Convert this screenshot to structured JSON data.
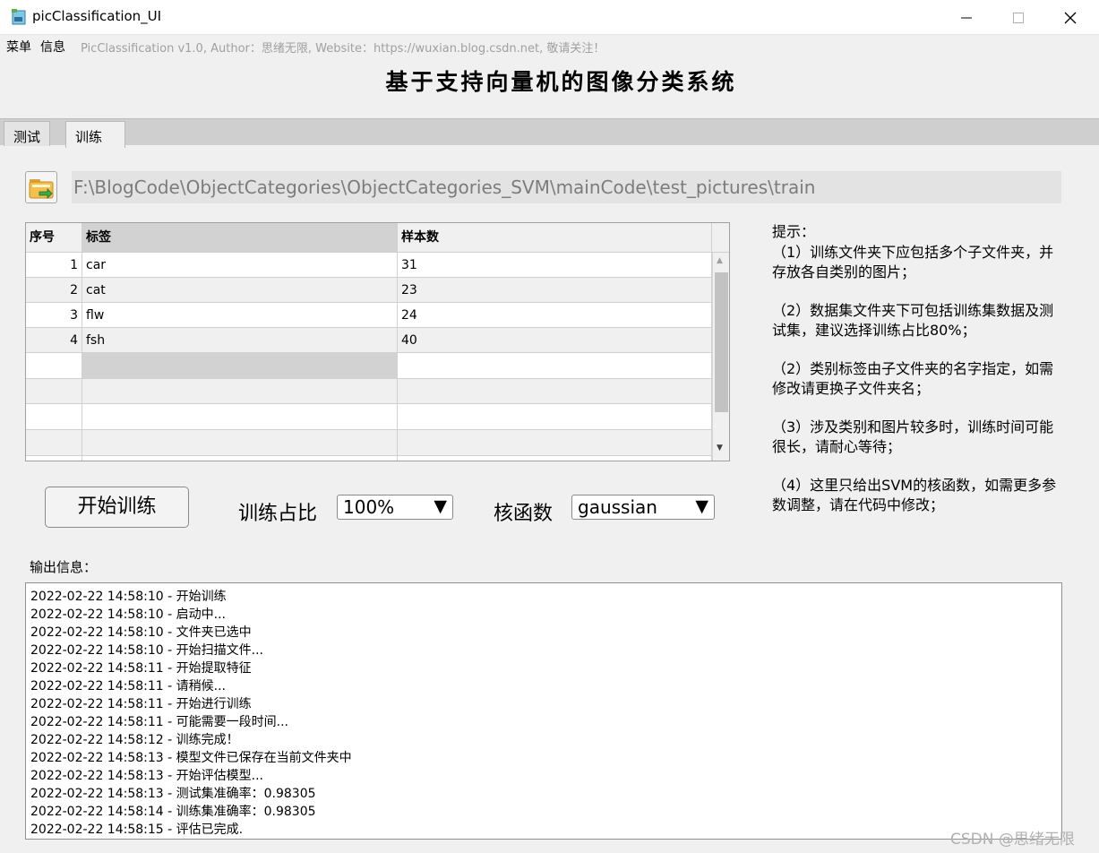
{
  "window": {
    "title": "picClassification_UI"
  },
  "menu": {
    "file": "菜单",
    "info": "信息",
    "credit": "PicClassification v1.0, Author：思绪无限, Website：https://wuxian.blog.csdn.net, 敬请关注！"
  },
  "heading": "基于支持向量机的图像分类系统",
  "tabs": {
    "test": "测试",
    "train": "训练"
  },
  "path": "F:\\BlogCode\\ObjectCategories\\ObjectCategories_SVM\\mainCode\\test_pictures\\train",
  "table": {
    "headers": [
      "序号",
      "标签",
      "样本数"
    ],
    "rows": [
      {
        "index": "1",
        "label": "car",
        "count": "31"
      },
      {
        "index": "2",
        "label": "cat",
        "count": "23"
      },
      {
        "index": "3",
        "label": "flw",
        "count": "24"
      },
      {
        "index": "4",
        "label": "fsh",
        "count": "40"
      }
    ]
  },
  "hints": {
    "title": "提示：",
    "items": [
      "（1）训练文件夹下应包括多个子文件夹，并存放各自类别的图片；",
      "（2）数据集文件夹下可包括训练集数据及测试集，建议选择训练占比80%；",
      "（2）类别标签由子文件夹的名字指定，如需修改请更换子文件夹名；",
      "（3）涉及类别和图片较多时，训练时间可能很长，请耐心等待；",
      "（4）这里只给出SVM的核函数，如需更多参数调整，请在代码中修改；"
    ]
  },
  "controls": {
    "start_label": "开始训练",
    "ratio_label": "训练占比",
    "ratio_value": "100%",
    "kernel_label": "核函数",
    "kernel_value": "gaussian"
  },
  "output": {
    "label": "输出信息：",
    "lines": [
      "2022-02-22 14:58:10 - 开始训练",
      "2022-02-22 14:58:10 - 启动中...",
      "2022-02-22 14:58:10 - 文件夹已选中",
      "2022-02-22 14:58:10 - 开始扫描文件...",
      "2022-02-22 14:58:11 - 开始提取特征",
      "2022-02-22 14:58:11 - 请稍候...",
      "2022-02-22 14:58:11 - 开始进行训练",
      "2022-02-22 14:58:11 - 可能需要一段时间...",
      "2022-02-22 14:58:12 - 训练完成！",
      "2022-02-22 14:58:13 - 模型文件已保存在当前文件夹中",
      "2022-02-22 14:58:13 - 开始评估模型...",
      "2022-02-22 14:58:13 - 测试集准确率：0.98305",
      "2022-02-22 14:58:14 - 训练集准确率：0.98305",
      "2022-02-22 14:58:15 - 评估已完成."
    ]
  },
  "watermark": "CSDN @思绪无限",
  "icons": {
    "app": "app-icon",
    "minimize": "minimize-icon",
    "maximize": "maximize-icon",
    "close": "close-icon",
    "folder": "folder-open-icon",
    "dropdown": "dropdown-arrow-icon"
  },
  "colors": {
    "tab_strip": "#cfcfcf",
    "path_field": "#e3e3e3",
    "selected_cell": "#d2d2d2"
  }
}
